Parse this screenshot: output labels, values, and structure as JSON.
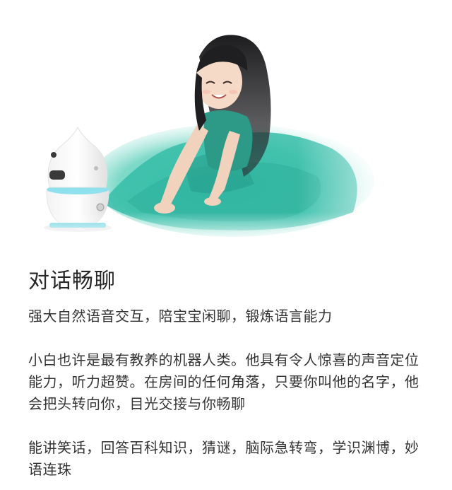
{
  "hero": {
    "image": "girl-with-robot-photo",
    "accent_color": "#3fc3b0"
  },
  "article": {
    "title": "对话畅聊",
    "subtitle": "强大自然语音交互，陪宝宝闲聊，锻炼语言能力",
    "paragraph_1": "小白也许是最有教养的机器人类。他具有令人惊喜的声音定位能力，听力超赞。在房间的任何角落，只要你叫他的名字，他会把头转向你，目光交接与你畅聊",
    "paragraph_2": "能讲笑话，回答百科知识，猜谜，脑际急转弯，学识渊博，妙语连珠"
  }
}
